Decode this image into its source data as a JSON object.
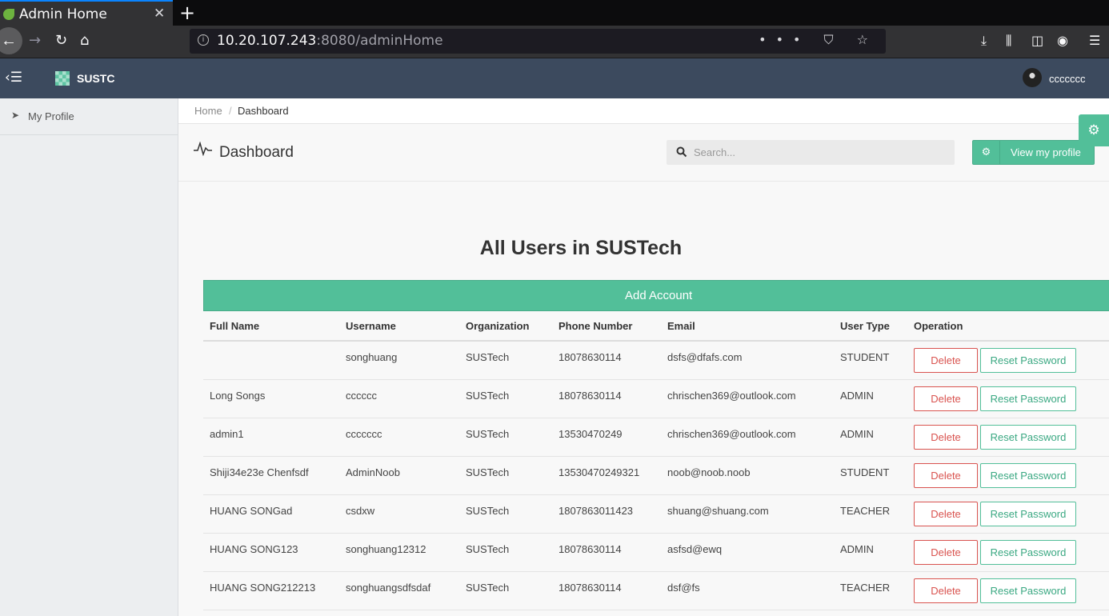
{
  "browser": {
    "tab_title": "Admin Home",
    "tab_close": "✕",
    "new_tab": "+",
    "url_host": "10.20.107.243",
    "url_rest": ":8080/adminHome",
    "url_actions": "••• ⛉ ☆"
  },
  "header": {
    "brand": "SUSTC",
    "username": "ccccccc"
  },
  "sidebar": {
    "items": [
      {
        "label": "My Profile",
        "icon": "location-arrow-icon"
      }
    ]
  },
  "breadcrumb": {
    "home": "Home",
    "separator": "/",
    "current": "Dashboard"
  },
  "page": {
    "title": "Dashboard",
    "search_placeholder": "Search...",
    "profile_button": "View my profile"
  },
  "users": {
    "heading": "All Users in SUSTech",
    "add_button": "Add Account",
    "columns": [
      "Full Name",
      "Username",
      "Organization",
      "Phone Number",
      "Email",
      "User Type",
      "Operation"
    ],
    "delete_label": "Delete",
    "reset_label": "Reset Password",
    "rows": [
      {
        "full_name": "",
        "username": "songhuang",
        "organization": "SUSTech",
        "phone": "18078630114",
        "email": "dsfs@dfafs.com",
        "type": "STUDENT"
      },
      {
        "full_name": "Long Songs",
        "username": "cccccc",
        "organization": "SUSTech",
        "phone": "18078630114",
        "email": "chrischen369@outlook.com",
        "type": "ADMIN"
      },
      {
        "full_name": "admin1",
        "username": "ccccccc",
        "organization": "SUSTech",
        "phone": "13530470249",
        "email": "chrischen369@outlook.com",
        "type": "ADMIN"
      },
      {
        "full_name": "Shiji34e23e Chenfsdf",
        "username": "AdminNoob",
        "organization": "SUSTech",
        "phone": "13530470249321",
        "email": "noob@noob.noob",
        "type": "STUDENT"
      },
      {
        "full_name": "HUANG SONGad",
        "username": "csdxw",
        "organization": "SUSTech",
        "phone": "1807863011423",
        "email": "shuang@shuang.com",
        "type": "TEACHER"
      },
      {
        "full_name": "HUANG SONG123",
        "username": "songhuang12312",
        "organization": "SUSTech",
        "phone": "18078630114",
        "email": "asfsd@ewq",
        "type": "ADMIN"
      },
      {
        "full_name": "HUANG SONG212213",
        "username": "songhuangsdfsdaf",
        "organization": "SUSTech",
        "phone": "18078630114",
        "email": "dsf@fs",
        "type": "TEACHER"
      }
    ]
  },
  "colors": {
    "accent": "#52bf99",
    "header_bg": "#3c4a5e",
    "danger": "#d9534f"
  }
}
